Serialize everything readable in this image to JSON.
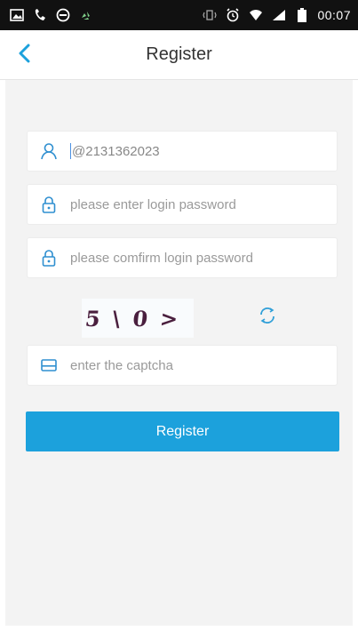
{
  "status_bar": {
    "time": "00:07",
    "left_icons": [
      "gallery-icon",
      "missed-call-icon",
      "do-not-disturb-icon",
      "recycle-icon"
    ],
    "right_icons": [
      "vibrate-icon",
      "alarm-icon",
      "wifi-icon",
      "signal-icon",
      "battery-icon"
    ]
  },
  "app_bar": {
    "title": "Register",
    "back_icon": "chevron-left-icon"
  },
  "form": {
    "account": {
      "value": "@2131362023",
      "icon": "user-icon"
    },
    "password": {
      "placeholder": "please enter login password",
      "icon": "lock-icon"
    },
    "confirm_password": {
      "placeholder": "please comfirm login password",
      "icon": "lock-icon"
    },
    "captcha": {
      "image_text": "5\\0>",
      "refresh_icon": "refresh-icon"
    },
    "captcha_input": {
      "placeholder": "enter the captcha",
      "icon": "card-icon"
    },
    "submit_label": "Register"
  },
  "colors": {
    "accent": "#1ca1dc",
    "status_bar": "#111111",
    "background": "#f3f3f3"
  }
}
